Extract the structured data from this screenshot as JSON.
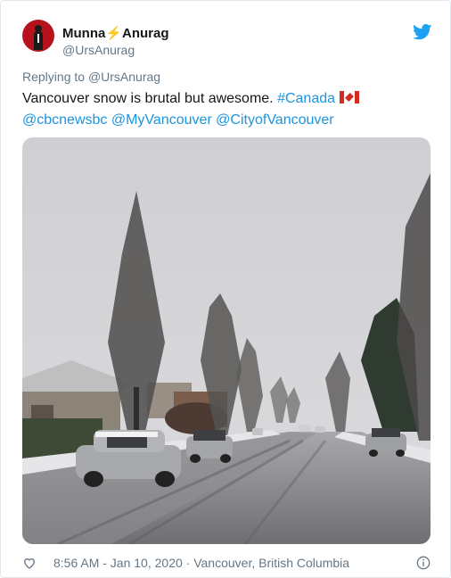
{
  "author": {
    "name": "Munna⚡Anurag",
    "handle": "@UrsAnurag"
  },
  "reply": {
    "prefix": "Replying to",
    "to": "@UrsAnurag"
  },
  "tweet": {
    "text": "Vancouver snow is brutal but awesome. ",
    "hashtag": "#Canada",
    "mentions": [
      "@cbcnewsbc",
      "@MyVancouver",
      "@CityofVancouver"
    ]
  },
  "footer": {
    "time": "8:56 AM - Jan 10, 2020",
    "separator": "·",
    "location": "Vancouver, British Columbia"
  },
  "icons": {
    "brand": "twitter-bird-icon",
    "like": "heart-icon",
    "info": "info-icon"
  },
  "colors": {
    "link": "#1b95e0",
    "twitter_blue": "#1da1f2",
    "muted": "#657786",
    "text": "#14171a"
  }
}
